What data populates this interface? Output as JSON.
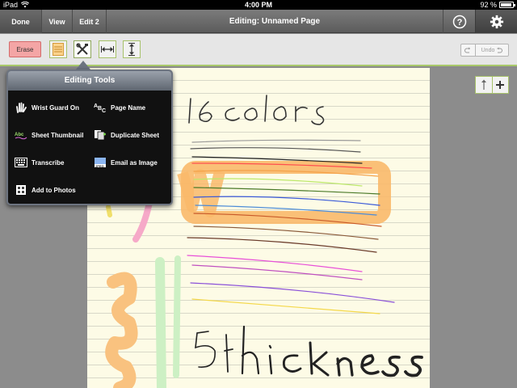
{
  "status_bar": {
    "device": "iPad",
    "time": "4:00 PM",
    "battery": "92 %"
  },
  "nav": {
    "done_label": "Done",
    "view_label": "View",
    "edit_label": "Edit 2",
    "title": "Editing: Unnamed Page"
  },
  "toolbar": {
    "erase_label": "Erase",
    "undo_label": "Undo"
  },
  "popover": {
    "title": "Editing Tools",
    "items": [
      {
        "label": "Wrist Guard On",
        "icon": "hand-icon"
      },
      {
        "label": "Page Name",
        "icon": "abc-icon"
      },
      {
        "label": "Sheet Thumbnail",
        "icon": "thumbnail-icon"
      },
      {
        "label": "Duplicate Sheet",
        "icon": "duplicate-icon"
      },
      {
        "label": "Transcribe",
        "icon": "keyboard-icon"
      },
      {
        "label": "Email as Image",
        "icon": "jpeg-icon"
      },
      {
        "label": "Add to Photos",
        "icon": "photos-icon"
      }
    ]
  },
  "colors": {
    "accent_green": "#a8c86a",
    "erase_red": "#f4a5a5",
    "paper": "#fdfbe6",
    "ink": "#222222"
  }
}
